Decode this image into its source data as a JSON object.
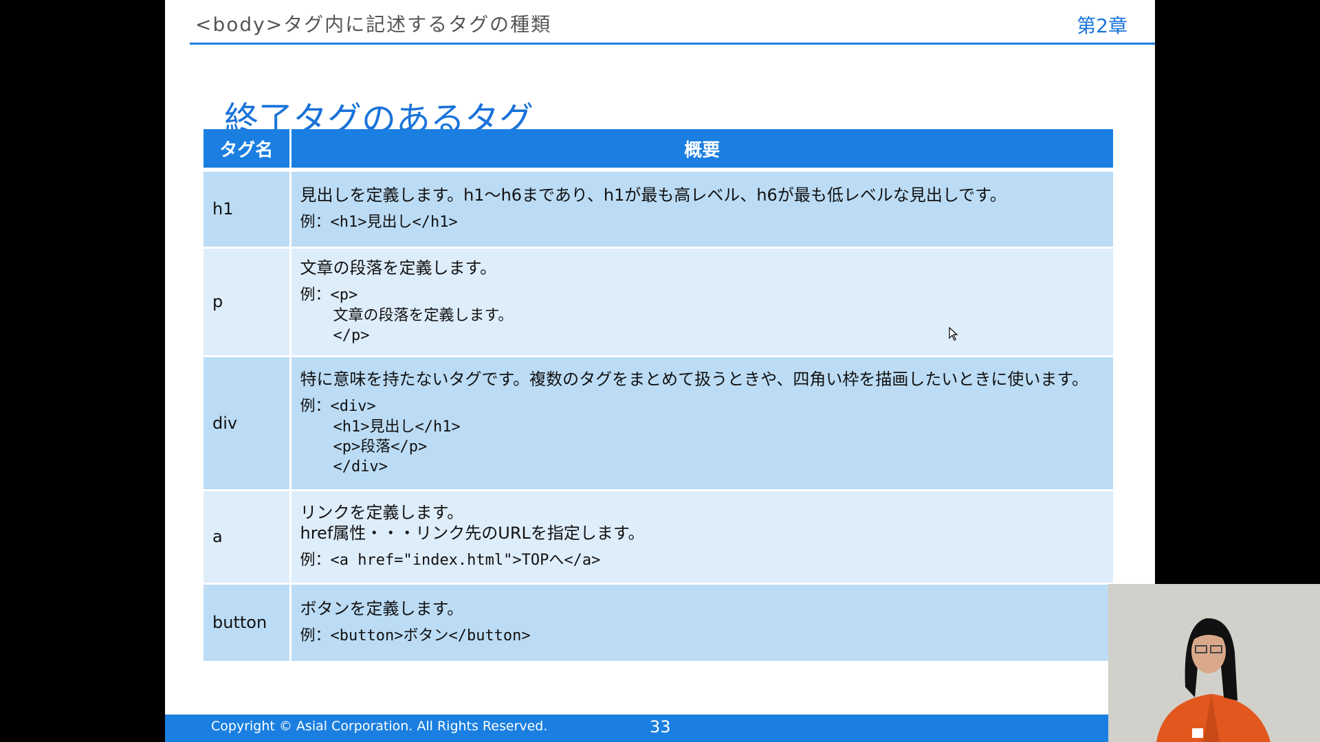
{
  "header": {
    "title": "<body>タグ内に記述するタグの種類",
    "chapter": "第2章"
  },
  "slide_title": "終了タグのあるタグ",
  "table": {
    "headers": [
      "タグ名",
      "概要"
    ],
    "rows": [
      {
        "tag": "h1",
        "desc": [
          "見出しを定義します。h1〜h6まであり、h1が最も高レベル、h6が最も低レベルな見出しです。"
        ],
        "example_first": "例：<h1>見出し</h1>",
        "example_rest": []
      },
      {
        "tag": "p",
        "desc": [
          "文章の段落を定義します。"
        ],
        "example_first": "例：<p>",
        "example_rest": [
          "文章の段落を定義します。",
          "</p>"
        ]
      },
      {
        "tag": "div",
        "desc": [
          "特に意味を持たないタグです。複数のタグをまとめて扱うときや、四角い枠を描画したいときに使います。"
        ],
        "example_first": "例：<div>",
        "example_rest": [
          "<h1>見出し</h1>",
          "<p>段落</p>",
          "</div>"
        ]
      },
      {
        "tag": "a",
        "desc": [
          "リンクを定義します。",
          "href属性・・・リンク先のURLを指定します。"
        ],
        "example_first": "例：<a href=\"index.html\">TOPへ</a>",
        "example_rest": []
      },
      {
        "tag": "button",
        "desc": [
          "ボタンを定義します。"
        ],
        "example_first": "例：<button>ボタン</button>",
        "example_rest": []
      }
    ]
  },
  "footer": {
    "copyright": "Copyright ©  Asial Corporation. All Rights Reserved.",
    "page": "33"
  },
  "icons": {
    "cursor": "mouse-pointer-icon"
  },
  "colors": {
    "accent": "#1a7fe0",
    "row_dark": "#bcdcf5",
    "row_light": "#deedfa"
  }
}
